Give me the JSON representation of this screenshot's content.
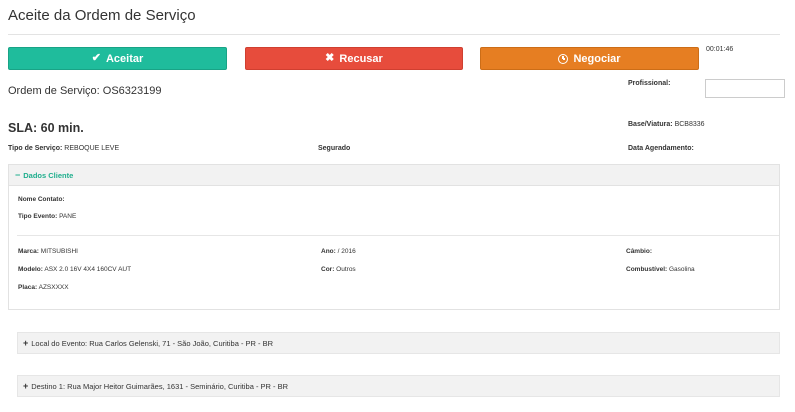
{
  "page": {
    "title": "Aceite da Ordem de Serviço"
  },
  "actions": {
    "accept_label": "Aceitar",
    "refuse_label": "Recusar",
    "negotiate_label": "Negociar"
  },
  "timer": "00:01:46",
  "order": {
    "number_text": "Ordem de Serviço: OS6323199"
  },
  "professional": {
    "label": "Profissional:",
    "value": ""
  },
  "sla": {
    "text": "SLA: 60 min."
  },
  "base": {
    "label": "Base/Viatura:",
    "value": "BCB8336"
  },
  "service": {
    "type_label": "Tipo de Serviço:",
    "type_value": "REBOQUE LEVE",
    "insured_label": "Segurado",
    "schedule_label": "Data Agendamento:"
  },
  "client_panel": {
    "title": "Dados Cliente",
    "contact_label": "Nome Contato:",
    "event_type_label": "Tipo Evento:",
    "event_type_value": "PANE",
    "brand_label": "Marca:",
    "brand_value": "MITSUBISHI",
    "year_label": "Ano:",
    "year_value": "/ 2016",
    "gearbox_label": "Câmbio:",
    "model_label": "Modelo:",
    "model_value": "ASX 2.0 16V 4X4 160CV AUT",
    "color_label": "Cor:",
    "color_value": "Outros",
    "fuel_label": "Combustível:",
    "fuel_value": "Gasolina",
    "plate_label": "Placa:",
    "plate_value": "AZSXXXX"
  },
  "event_location": {
    "text": "Local do Evento: Rua Carlos Gelenski, 71 - São João, Curitiba - PR - BR"
  },
  "destination": {
    "text": "Destino 1: Rua Major Heitor Guimarães, 1631 - Seminário, Curitiba - PR - BR"
  },
  "colors": {
    "accept": "#1fbc9c",
    "refuse": "#e74c3c",
    "negotiate": "#e67e22",
    "panel_title": "#1fae8d"
  },
  "icons": {
    "accept": "check-icon",
    "refuse": "times-icon",
    "negotiate": "clock-icon",
    "panel_toggle": "minus-icon",
    "expand": "plus-icon"
  }
}
